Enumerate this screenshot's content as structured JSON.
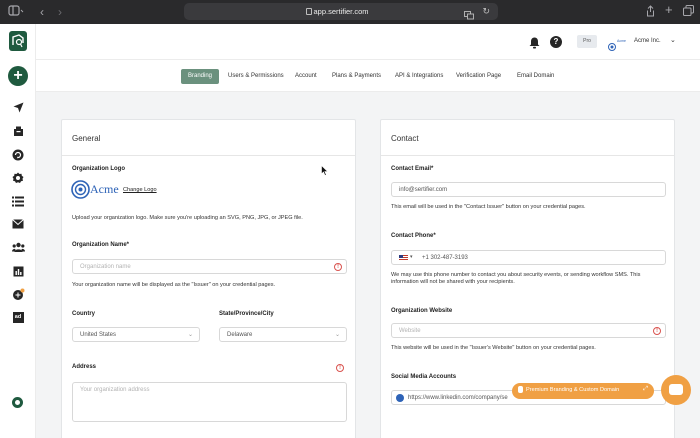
{
  "browser": {
    "url": "app.sertifier.com"
  },
  "topbar": {
    "plan_badge": "Pro",
    "account_name": "Acme Inc.",
    "mini_logo_text": "Acme"
  },
  "tabs": [
    {
      "label": "Branding",
      "active": true
    },
    {
      "label": "Users & Permissions",
      "active": false
    },
    {
      "label": "Account",
      "active": false
    },
    {
      "label": "Plans & Payments",
      "active": false
    },
    {
      "label": "API & Integrations",
      "active": false
    },
    {
      "label": "Verification Page",
      "active": false
    },
    {
      "label": "Email Domain",
      "active": false
    }
  ],
  "sidebar": {
    "badge_text": "ad",
    "items": [
      "add",
      "send",
      "inbox",
      "recycle",
      "badge",
      "list",
      "mail",
      "users",
      "chart",
      "integrations",
      "ad"
    ]
  },
  "general": {
    "title": "General",
    "org_logo_label": "Organization Logo",
    "logo_text": "Acme",
    "change_logo": "Change Logo",
    "logo_help": "Upload your organization logo. Make sure you're uploading an SVG, PNG, JPG, or JPEG file.",
    "org_name_label": "Organization Name*",
    "org_name_placeholder": "Organization name",
    "org_name_help": "Your organization name will be displayed as the \"Issuer\" on your credential pages.",
    "country_label": "Country",
    "country_value": "United States",
    "state_label": "State/Province/City",
    "state_value": "Delaware",
    "address_label": "Address",
    "address_placeholder": "Your organization address"
  },
  "contact": {
    "title": "Contact",
    "email_label": "Contact Email*",
    "email_value": "info@sertifier.com",
    "email_help": "This email will be used in the \"Contact Issuer\" button on your credential pages.",
    "phone_label": "Contact Phone*",
    "phone_value": "+1 302-487-3193",
    "phone_help": "We may use this phone number to contact you about security events, or sending workflow SMS. This information will not be shared with your recipients.",
    "website_label": "Organization Website",
    "website_placeholder": "Website",
    "website_help": "This website will be used in the \"Issuer's Website\" button on your credential pages.",
    "social_label": "Social Media Accounts",
    "social_value": "https://www.linkedin.com/company/se"
  },
  "promo": {
    "label": "Premium Branding & Custom Domain"
  },
  "colors": {
    "accent": "#6b917e",
    "brand_dark": "#1f5a3f",
    "promo": "#f0a044",
    "error": "#d9534f"
  }
}
